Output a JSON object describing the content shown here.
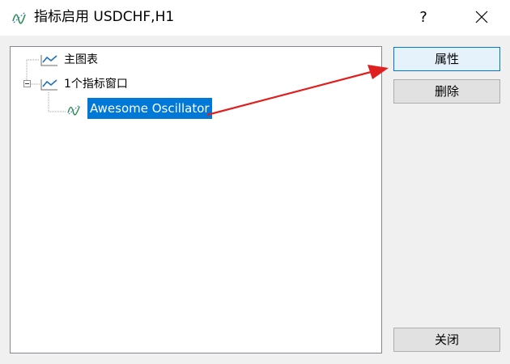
{
  "window": {
    "title": "指标启用 USDCHF,H1",
    "help_label": "?",
    "title_icon": "indicator-wave-icon",
    "close_icon": "close-icon"
  },
  "tree": {
    "nodes": [
      {
        "label": "主图表",
        "icon": "chart-line-icon",
        "level": 0
      },
      {
        "label": "1个指标窗口",
        "icon": "chart-line-icon",
        "level": 0,
        "expanded": true
      },
      {
        "label": "Awesome Oscillator",
        "icon": "indicator-wave-icon",
        "level": 1,
        "selected": true
      }
    ]
  },
  "buttons": {
    "properties": "属性",
    "delete": "删除",
    "close": "关闭"
  },
  "colors": {
    "accent": "#0078d7",
    "selection_bg": "#0078d7",
    "annotation_arrow": "#e02020"
  }
}
